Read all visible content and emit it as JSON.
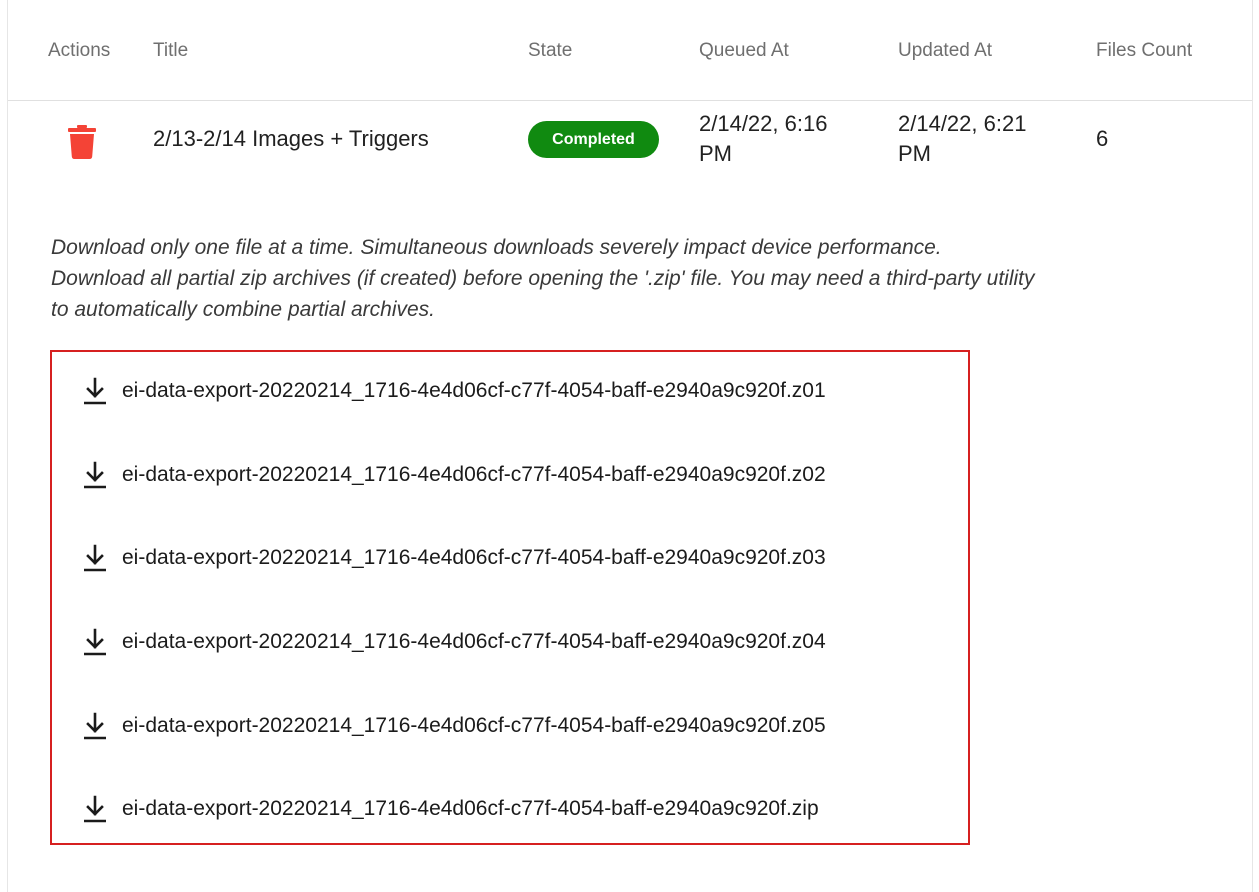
{
  "table": {
    "headers": {
      "actions": "Actions",
      "title": "Title",
      "state": "State",
      "queued_at": "Queued At",
      "updated_at": "Updated At",
      "files_count": "Files Count"
    },
    "row": {
      "title": "2/13-2/14 Images + Triggers",
      "state": "Completed",
      "queued_at_line1": "2/14/22, 6:16",
      "queued_at_line2": "PM",
      "updated_at_line1": "2/14/22, 6:21",
      "updated_at_line2": "PM",
      "files_count": "6",
      "delete_icon": "trash-icon"
    }
  },
  "notice": {
    "line1": "Download only one file at a time. Simultaneous downloads severely impact device performance.",
    "line2": "Download all partial zip archives (if created) before opening the '.zip' file. You may need a third-party utility",
    "line3": "to automatically combine partial archives."
  },
  "files": [
    {
      "name": "ei-data-export-20220214_1716-4e4d06cf-c77f-4054-baff-e2940a9c920f.z01",
      "icon": "download-icon"
    },
    {
      "name": "ei-data-export-20220214_1716-4e4d06cf-c77f-4054-baff-e2940a9c920f.z02",
      "icon": "download-icon"
    },
    {
      "name": "ei-data-export-20220214_1716-4e4d06cf-c77f-4054-baff-e2940a9c920f.z03",
      "icon": "download-icon"
    },
    {
      "name": "ei-data-export-20220214_1716-4e4d06cf-c77f-4054-baff-e2940a9c920f.z04",
      "icon": "download-icon"
    },
    {
      "name": "ei-data-export-20220214_1716-4e4d06cf-c77f-4054-baff-e2940a9c920f.z05",
      "icon": "download-icon"
    },
    {
      "name": "ei-data-export-20220214_1716-4e4d06cf-c77f-4054-baff-e2940a9c920f.zip",
      "icon": "download-icon"
    }
  ],
  "colors": {
    "state_completed": "#108a10",
    "delete_icon": "#f44336",
    "highlight_border": "#d62020"
  }
}
